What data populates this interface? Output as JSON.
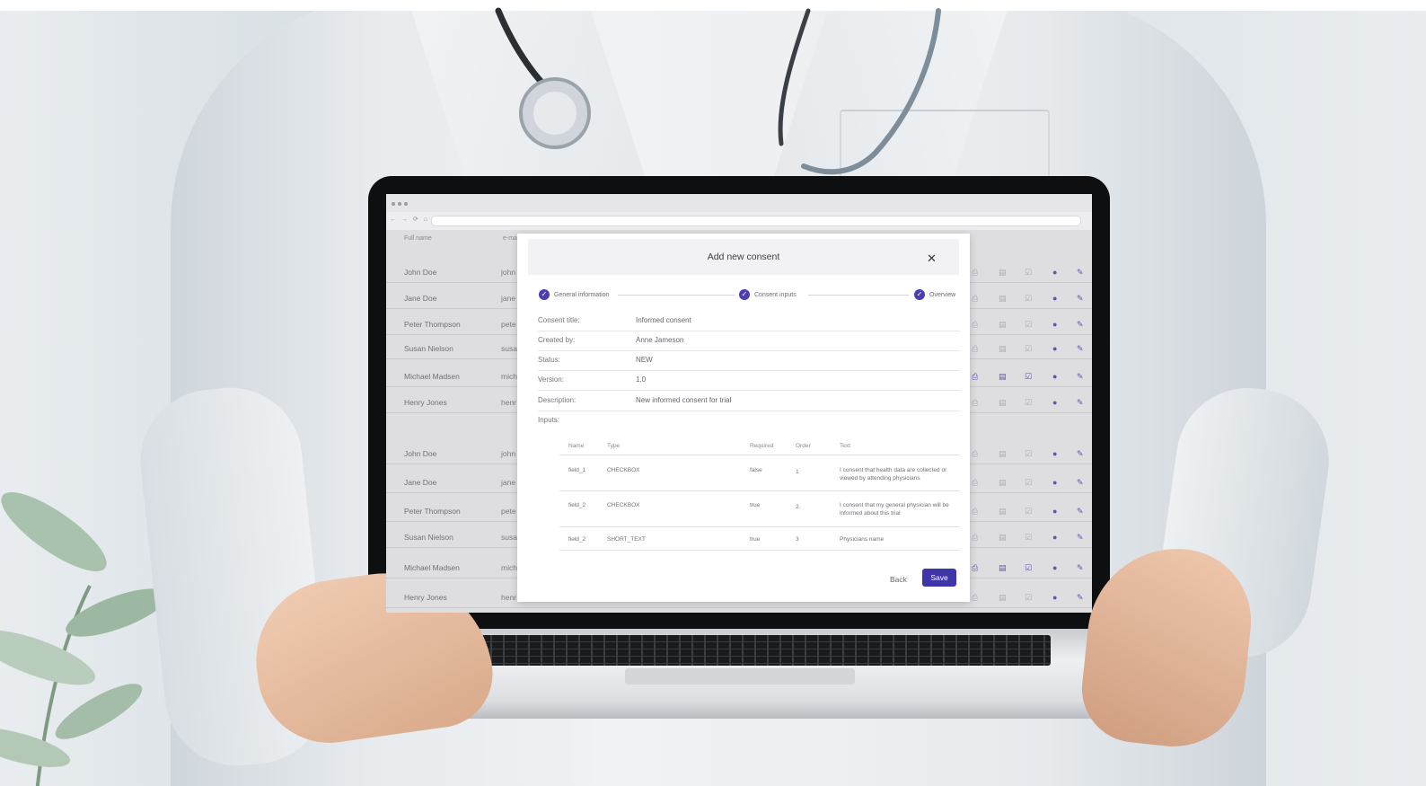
{
  "browser": {
    "nav_glyphs": "← → ⟳ ⌂"
  },
  "background_table": {
    "headers": [
      "Full name",
      "e-ma"
    ],
    "rows": [
      {
        "name": "John Doe",
        "email": "john",
        "highlight": false
      },
      {
        "name": "Jane Doe",
        "email": "jane",
        "highlight": false
      },
      {
        "name": "Peter Thompson",
        "email": "pete",
        "highlight": false
      },
      {
        "name": "Susan Nielson",
        "email": "susa",
        "highlight": false
      },
      {
        "name": "Michael Madsen",
        "email": "mich",
        "highlight": true
      },
      {
        "name": "Henry Jones",
        "email": "henr",
        "highlight": false
      },
      {
        "name": "John Doe",
        "email": "john",
        "highlight": false
      },
      {
        "name": "Jane Doe",
        "email": "jane",
        "highlight": false
      },
      {
        "name": "Peter Thompson",
        "email": "pete",
        "highlight": false
      },
      {
        "name": "Susan Nielson",
        "email": "susa",
        "highlight": false
      },
      {
        "name": "Michael Madsen",
        "email": "mich",
        "highlight": true
      },
      {
        "name": "Henry Jones",
        "email": "henr",
        "highlight": false
      }
    ],
    "icons": [
      "printer-icon",
      "document-icon",
      "checkbox-icon",
      "info-icon",
      "edit-icon"
    ]
  },
  "modal": {
    "title": "Add new consent",
    "close_glyph": "✕",
    "steps": [
      {
        "label": "General information",
        "glyph": "✓"
      },
      {
        "label": "Consent inputs",
        "glyph": "✓"
      },
      {
        "label": "Overview",
        "glyph": "✓"
      }
    ],
    "fields": [
      {
        "key": "Consent title:",
        "value": "Informed consent"
      },
      {
        "key": "Created by:",
        "value": "Anne Jameson"
      },
      {
        "key": "Status:",
        "value": "NEW"
      },
      {
        "key": "Version:",
        "value": "1.0"
      },
      {
        "key": "Description:",
        "value": "New informed consent for trial"
      },
      {
        "key": "Inputs:",
        "value": ""
      }
    ],
    "inputs_table": {
      "headers": [
        "Name",
        "Type",
        "Required",
        "Order",
        "Text"
      ],
      "rows": [
        {
          "name": "field_1",
          "type": "CHECKBOX",
          "required": "false",
          "order": "1",
          "text": "I consent that health data are collected or viewed by attending physicians"
        },
        {
          "name": "field_2",
          "type": "CHECKBOX",
          "required": "true",
          "order": "2",
          "text": "I consent that my general physician will be informed about this trial"
        },
        {
          "name": "field_2",
          "type": "SHORT_TEXT",
          "required": "true",
          "order": "3",
          "text": "Physicians name"
        }
      ]
    },
    "back_label": "Back",
    "save_label": "Save"
  },
  "colors": {
    "accent": "#3f35a8",
    "icon_purple": "#5a4fb8",
    "icon_grey": "#b7b7bd"
  }
}
